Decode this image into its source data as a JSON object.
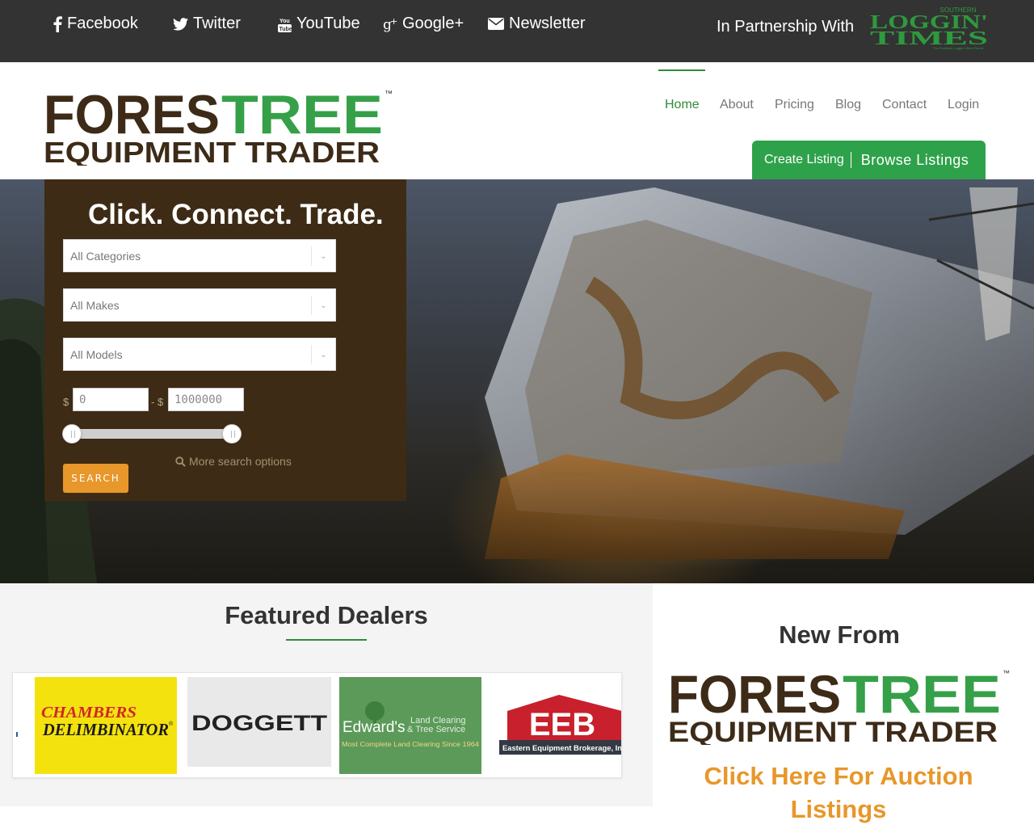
{
  "topbar": {
    "social": [
      {
        "label": "Facebook",
        "icon": "facebook-icon"
      },
      {
        "label": "Twitter",
        "icon": "twitter-icon"
      },
      {
        "label": "YouTube",
        "icon": "youtube-icon"
      },
      {
        "label": "Google+",
        "icon": "google-plus-icon"
      },
      {
        "label": "Newsletter",
        "icon": "envelope-icon"
      }
    ],
    "partner_text": "In Partnership With",
    "partner_logo": {
      "line1": "SOUTHERN",
      "line2": "LOGGIN'",
      "line3": "TIMES",
      "tagline": "The Southern Logger's Best Friend",
      "color": "#2e9a3e"
    }
  },
  "brand": {
    "word1": "FORES",
    "word2": "TREE",
    "subtitle": "EQUIPMENT TRADER",
    "tm": "™",
    "brown": "#3d2b18",
    "green": "#35a048"
  },
  "nav": {
    "items": [
      "Home",
      "About",
      "Pricing",
      "Blog",
      "Contact",
      "Login"
    ],
    "active": "Home",
    "create_listing": "Create Listing",
    "browse_listings": "Browse Listings"
  },
  "search": {
    "title": "Click. Connect. Trade.",
    "category_placeholder": "All Categories",
    "make_placeholder": "All Makes",
    "model_placeholder": "All Models",
    "currency": "$",
    "range_sep": "- $",
    "price_min": "0",
    "price_max": "1000000",
    "more_options": "More search options",
    "button": "SEARCH"
  },
  "dealers": {
    "title": "Featured Dealers",
    "items": [
      {
        "name": "chambers-delimbinator",
        "line1": "CHAMBERS",
        "line2": "DELIMBINATOR",
        "mark": "®"
      },
      {
        "name": "doggett",
        "line1": "DOGGETT"
      },
      {
        "name": "edwards",
        "line1": "Edward's",
        "line2": "Land Clearing",
        "line3": "& Tree Service",
        "line4": "Most Complete Land Clearing Since 1964"
      },
      {
        "name": "eeb",
        "line1": "EEB",
        "line2": "Eastern Equipment Brokerage, In"
      }
    ]
  },
  "promo": {
    "title": "New From",
    "link": "Click Here For Auction Listings"
  },
  "colors": {
    "accent_green": "#2e8b3a",
    "cta_green": "#2ea24a",
    "orange": "#e8972a",
    "panel_brown": "#3e2b15",
    "topbar": "#333333"
  }
}
